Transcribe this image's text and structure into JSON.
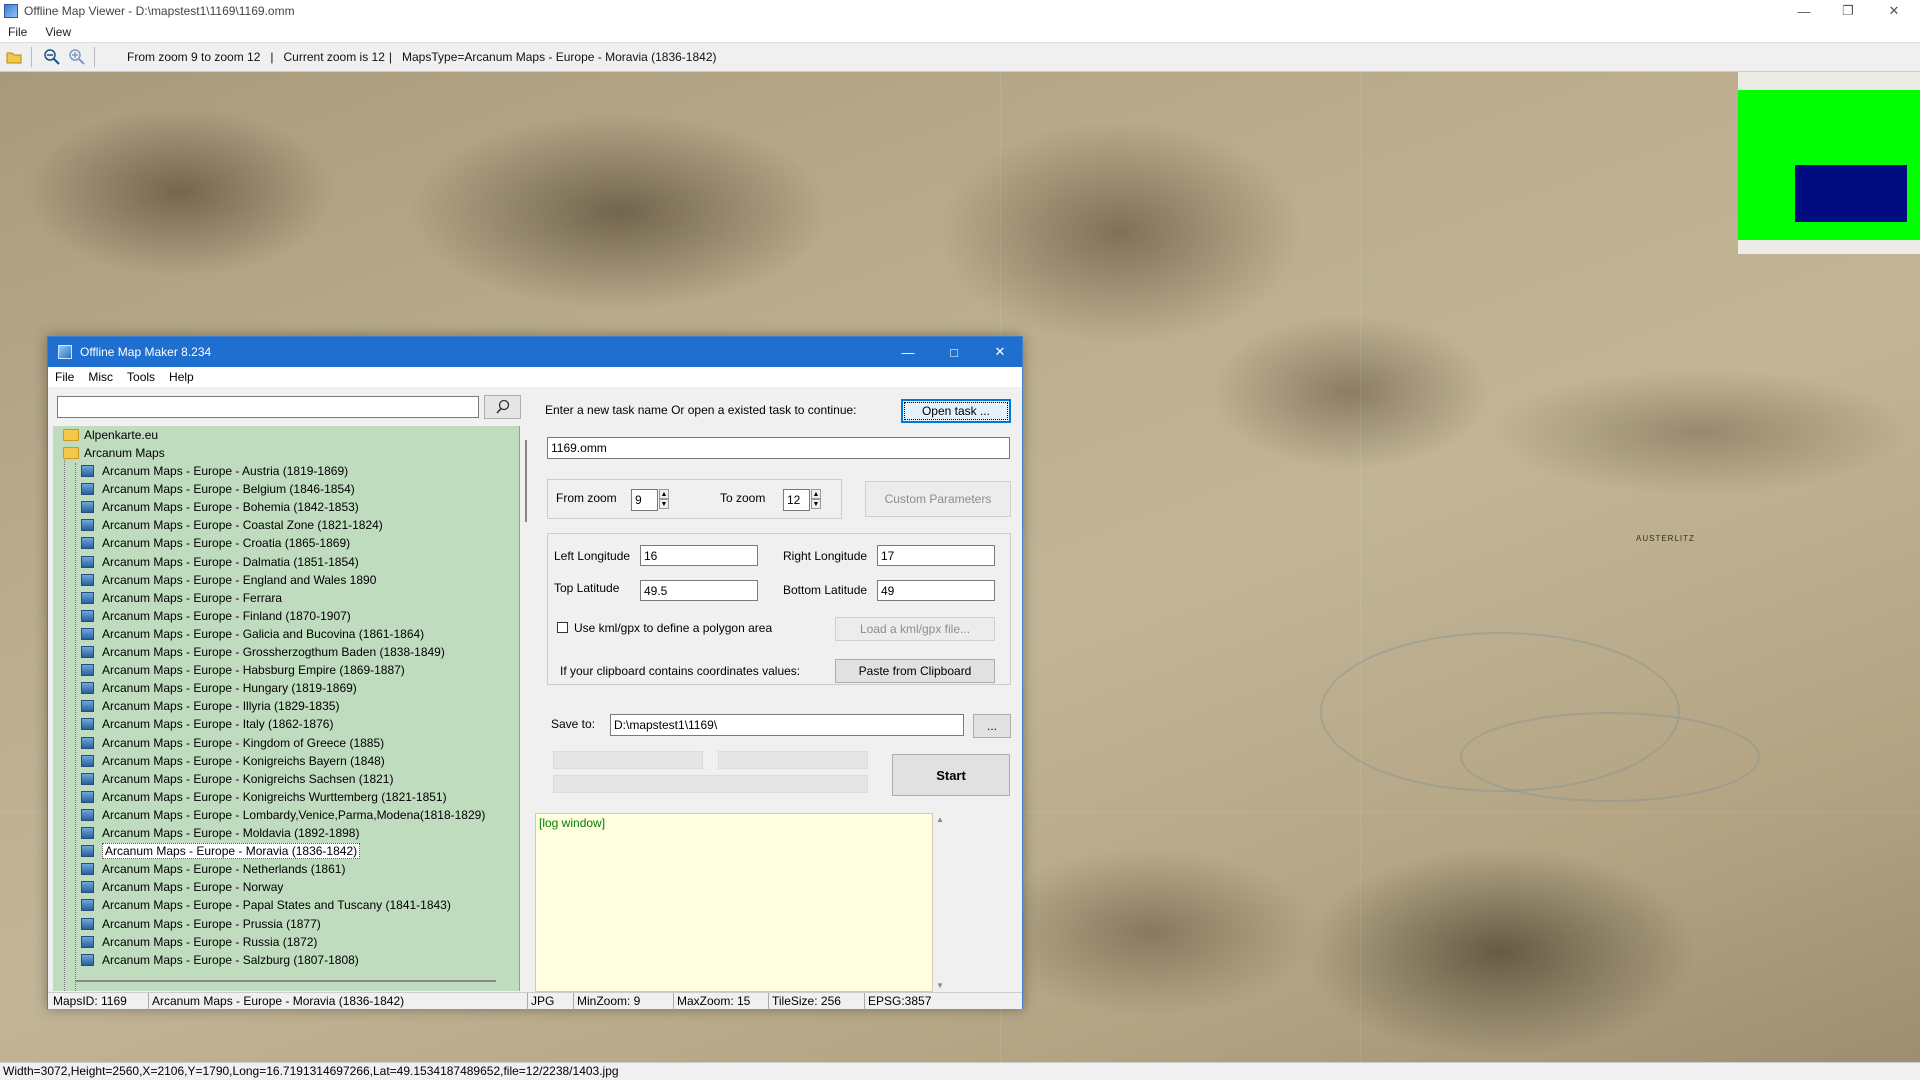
{
  "window": {
    "title": "Offline Map Viewer - D:\\mapstest1\\1169\\1169.omm"
  },
  "menu": [
    "File",
    "View"
  ],
  "toolbar": {
    "zoom_range": "From zoom 9 to zoom 12",
    "current_zoom": "Current zoom is 12",
    "maps_type": "MapsType=Arcanum Maps - Europe - Moravia (1836-1842)"
  },
  "status_bar": "Width=3072,Height=2560,X=2106,Y=1790,Long=16.7191314697266,Lat=49.1534187489652,file=12/2238/1403.jpg",
  "overview": {
    "bg_color": "#00ff00",
    "view_color": "#000c80"
  },
  "map": {
    "label": "AUSTERLITZ"
  },
  "dialog": {
    "title": "Offline Map Maker 8.234",
    "menu": [
      "File",
      "Misc",
      "Tools",
      "Help"
    ],
    "search_value": "",
    "tree": {
      "folders": [
        "Alpenkarte.eu",
        "Arcanum Maps"
      ],
      "items": [
        "Arcanum Maps - Europe - Austria (1819-1869)",
        "Arcanum Maps - Europe - Belgium (1846-1854)",
        "Arcanum Maps - Europe - Bohemia (1842-1853)",
        "Arcanum Maps - Europe - Coastal Zone (1821-1824)",
        "Arcanum Maps - Europe - Croatia (1865-1869)",
        "Arcanum Maps - Europe - Dalmatia (1851-1854)",
        "Arcanum Maps - Europe - England and Wales 1890",
        "Arcanum Maps - Europe - Ferrara",
        "Arcanum Maps - Europe - Finland (1870-1907)",
        "Arcanum Maps - Europe - Galicia and Bucovina (1861-1864)",
        "Arcanum Maps - Europe - Grossherzogthum Baden (1838-1849)",
        "Arcanum Maps - Europe - Habsburg Empire (1869-1887)",
        "Arcanum Maps - Europe - Hungary (1819-1869)",
        "Arcanum Maps - Europe - Illyria (1829-1835)",
        "Arcanum Maps - Europe - Italy (1862-1876)",
        "Arcanum Maps - Europe - Kingdom of Greece (1885)",
        "Arcanum Maps - Europe - Konigreichs Bayern (1848)",
        "Arcanum Maps - Europe - Konigreichs Sachsen (1821)",
        "Arcanum Maps - Europe - Konigreichs Wurttemberg (1821-1851)",
        "Arcanum Maps - Europe - Lombardy,Venice,Parma,Modena(1818-1829)",
        "Arcanum Maps - Europe - Moldavia (1892-1898)",
        "Arcanum Maps - Europe - Moravia (1836-1842)",
        "Arcanum Maps - Europe - Netherlands (1861)",
        "Arcanum Maps - Europe - Norway",
        "Arcanum Maps - Europe - Papal States and Tuscany (1841-1843)",
        "Arcanum Maps - Europe - Prussia (1877)",
        "Arcanum Maps - Europe - Russia (1872)",
        "Arcanum Maps - Europe - Salzburg (1807-1808)"
      ],
      "selected_index": 21
    },
    "task_prompt": "Enter a new task name Or open a existed task to continue:",
    "open_task_label": "Open task ...",
    "task_name": "1169.omm",
    "from_zoom_label": "From zoom",
    "from_zoom_value": "9",
    "to_zoom_label": "To zoom",
    "to_zoom_value": "12",
    "custom_params_label": "Custom Parameters",
    "left_lon_label": "Left Longitude",
    "left_lon_value": "16",
    "right_lon_label": "Right Longitude",
    "right_lon_value": "17",
    "top_lat_label": "Top Latitude",
    "top_lat_value": "49.5",
    "bottom_lat_label": "Bottom Latitude",
    "bottom_lat_value": "49",
    "kml_checkbox_label": "Use kml/gpx to define a polygon area",
    "load_kml_label": "Load a kml/gpx file...",
    "clipboard_prompt": "If your clipboard contains coordinates values:",
    "paste_label": "Paste from Clipboard",
    "save_to_label": "Save to:",
    "save_to_value": "D:\\mapstest1\\1169\\",
    "browse_label": "...",
    "start_label": "Start",
    "log_text": "[log window]",
    "status": {
      "maps_id": "MapsID: 1169",
      "map_name": "Arcanum Maps - Europe - Moravia (1836-1842)",
      "format": "JPG",
      "min_zoom": "MinZoom: 9",
      "max_zoom": "MaxZoom: 15",
      "tile_size": "TileSize: 256",
      "epsg": "EPSG:3857"
    }
  }
}
